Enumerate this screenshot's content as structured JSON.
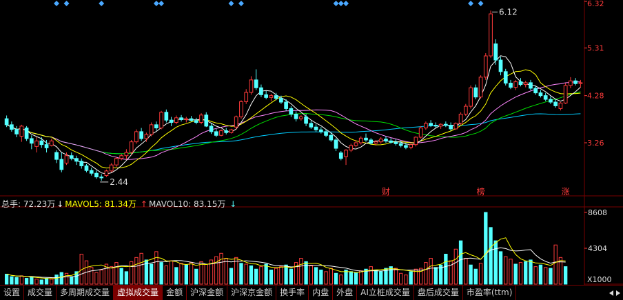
{
  "chart_data": {
    "type": "candlestick",
    "price_axis": {
      "ticks": [
        "6.32",
        "5.31",
        "4.28",
        "3.26"
      ]
    },
    "price_range": [
      2.2,
      6.32
    ],
    "annotations": {
      "max_label": "6.12",
      "min_label": "2.44"
    },
    "event_markers": [
      "财",
      "榜",
      "涨"
    ],
    "volume_axis": {
      "ticks": [
        "8608",
        "4304"
      ],
      "unit": "X1000"
    },
    "volume_range": [
      0,
      8608
    ],
    "colors": {
      "up": "#ff3b3b",
      "down": "#54ffff",
      "ma5": "#ffffff",
      "ma10": "#ffff00",
      "ma20": "#ff88ff",
      "ma30": "#00dd00",
      "ma60": "#00ccff",
      "marker": "#4aa8ff",
      "grid": "#7a0000"
    },
    "candles": [
      {
        "o": 3.78,
        "h": 3.85,
        "l": 3.6,
        "c": 3.65
      },
      {
        "o": 3.65,
        "h": 3.72,
        "l": 3.5,
        "c": 3.55
      },
      {
        "o": 3.55,
        "h": 3.62,
        "l": 3.38,
        "c": 3.45
      },
      {
        "o": 3.4,
        "h": 3.65,
        "l": 3.28,
        "c": 3.62
      },
      {
        "o": 3.58,
        "h": 3.62,
        "l": 3.3,
        "c": 3.35
      },
      {
        "o": 3.35,
        "h": 3.42,
        "l": 3.12,
        "c": 3.25
      },
      {
        "o": 3.18,
        "h": 3.38,
        "l": 3.05,
        "c": 3.3
      },
      {
        "o": 3.3,
        "h": 3.38,
        "l": 3.15,
        "c": 3.22
      },
      {
        "o": 3.22,
        "h": 3.32,
        "l": 3.05,
        "c": 3.15
      },
      {
        "o": 3.2,
        "h": 3.35,
        "l": 3.18,
        "c": 3.3
      },
      {
        "o": 3.05,
        "h": 3.1,
        "l": 2.82,
        "c": 2.9
      },
      {
        "o": 2.9,
        "h": 3.05,
        "l": 2.62,
        "c": 2.68
      },
      {
        "o": 2.82,
        "h": 3.05,
        "l": 2.78,
        "c": 2.98
      },
      {
        "o": 2.98,
        "h": 3.05,
        "l": 2.88,
        "c": 2.92
      },
      {
        "o": 2.92,
        "h": 2.98,
        "l": 2.78,
        "c": 2.86
      },
      {
        "o": 2.86,
        "h": 2.92,
        "l": 2.7,
        "c": 2.76
      },
      {
        "o": 2.76,
        "h": 2.8,
        "l": 2.62,
        "c": 2.66
      },
      {
        "o": 2.66,
        "h": 2.72,
        "l": 2.55,
        "c": 2.6
      },
      {
        "o": 2.6,
        "h": 2.66,
        "l": 2.48,
        "c": 2.52
      },
      {
        "o": 2.52,
        "h": 2.58,
        "l": 2.44,
        "c": 2.5
      },
      {
        "o": 2.55,
        "h": 2.68,
        "l": 2.52,
        "c": 2.65
      },
      {
        "o": 2.65,
        "h": 2.82,
        "l": 2.62,
        "c": 2.78
      },
      {
        "o": 2.78,
        "h": 2.95,
        "l": 2.74,
        "c": 2.92
      },
      {
        "o": 2.92,
        "h": 3.02,
        "l": 2.88,
        "c": 2.98
      },
      {
        "o": 2.98,
        "h": 3.12,
        "l": 2.9,
        "c": 3.05
      },
      {
        "o": 3.05,
        "h": 3.32,
        "l": 3.0,
        "c": 3.28
      },
      {
        "o": 3.28,
        "h": 3.55,
        "l": 3.24,
        "c": 3.5
      },
      {
        "o": 3.5,
        "h": 3.58,
        "l": 3.3,
        "c": 3.35
      },
      {
        "o": 3.35,
        "h": 3.48,
        "l": 3.28,
        "c": 3.44
      },
      {
        "o": 3.44,
        "h": 3.7,
        "l": 3.4,
        "c": 3.65
      },
      {
        "o": 3.65,
        "h": 3.72,
        "l": 3.52,
        "c": 3.58
      },
      {
        "o": 3.58,
        "h": 3.95,
        "l": 3.55,
        "c": 3.92
      },
      {
        "o": 3.92,
        "h": 3.98,
        "l": 3.7,
        "c": 3.75
      },
      {
        "o": 3.75,
        "h": 3.82,
        "l": 3.62,
        "c": 3.7
      },
      {
        "o": 3.7,
        "h": 3.85,
        "l": 3.66,
        "c": 3.8
      },
      {
        "o": 3.8,
        "h": 3.86,
        "l": 3.72,
        "c": 3.76
      },
      {
        "o": 3.76,
        "h": 3.82,
        "l": 3.7,
        "c": 3.78
      },
      {
        "o": 3.78,
        "h": 3.84,
        "l": 3.72,
        "c": 3.74
      },
      {
        "o": 3.74,
        "h": 3.8,
        "l": 3.66,
        "c": 3.7
      },
      {
        "o": 3.7,
        "h": 3.9,
        "l": 3.66,
        "c": 3.86
      },
      {
        "o": 3.86,
        "h": 3.92,
        "l": 3.6,
        "c": 3.62
      },
      {
        "o": 3.62,
        "h": 3.68,
        "l": 3.45,
        "c": 3.5
      },
      {
        "o": 3.5,
        "h": 3.56,
        "l": 3.38,
        "c": 3.42
      },
      {
        "o": 3.42,
        "h": 3.55,
        "l": 3.4,
        "c": 3.52
      },
      {
        "o": 3.52,
        "h": 3.58,
        "l": 3.44,
        "c": 3.48
      },
      {
        "o": 3.48,
        "h": 3.56,
        "l": 3.46,
        "c": 3.54
      },
      {
        "o": 3.6,
        "h": 3.85,
        "l": 3.55,
        "c": 3.82
      },
      {
        "o": 3.82,
        "h": 4.18,
        "l": 3.78,
        "c": 4.15
      },
      {
        "o": 4.15,
        "h": 4.42,
        "l": 4.1,
        "c": 4.35
      },
      {
        "o": 4.35,
        "h": 4.7,
        "l": 4.3,
        "c": 4.62
      },
      {
        "o": 4.62,
        "h": 4.85,
        "l": 4.4,
        "c": 4.45
      },
      {
        "o": 4.45,
        "h": 4.52,
        "l": 4.25,
        "c": 4.3
      },
      {
        "o": 4.3,
        "h": 4.38,
        "l": 4.2,
        "c": 4.24
      },
      {
        "o": 4.24,
        "h": 4.32,
        "l": 4.16,
        "c": 4.28
      },
      {
        "o": 4.28,
        "h": 4.34,
        "l": 4.18,
        "c": 4.22
      },
      {
        "o": 4.22,
        "h": 4.28,
        "l": 4.1,
        "c": 4.14
      },
      {
        "o": 4.14,
        "h": 4.2,
        "l": 3.95,
        "c": 4.0
      },
      {
        "o": 4.0,
        "h": 4.05,
        "l": 3.82,
        "c": 3.88
      },
      {
        "o": 3.88,
        "h": 3.94,
        "l": 3.72,
        "c": 3.78
      },
      {
        "o": 3.78,
        "h": 3.86,
        "l": 3.74,
        "c": 3.82
      },
      {
        "o": 3.82,
        "h": 3.88,
        "l": 3.62,
        "c": 3.68
      },
      {
        "o": 3.68,
        "h": 3.74,
        "l": 3.56,
        "c": 3.6
      },
      {
        "o": 3.6,
        "h": 3.66,
        "l": 3.5,
        "c": 3.54
      },
      {
        "o": 3.54,
        "h": 3.6,
        "l": 3.46,
        "c": 3.5
      },
      {
        "o": 3.5,
        "h": 3.55,
        "l": 3.38,
        "c": 3.42
      },
      {
        "o": 3.42,
        "h": 3.48,
        "l": 3.28,
        "c": 3.32
      },
      {
        "o": 3.32,
        "h": 3.36,
        "l": 3.08,
        "c": 3.14
      },
      {
        "o": 3.04,
        "h": 3.08,
        "l": 2.88,
        "c": 2.92
      },
      {
        "o": 2.96,
        "h": 3.12,
        "l": 2.78,
        "c": 3.1
      },
      {
        "o": 3.1,
        "h": 3.24,
        "l": 3.06,
        "c": 3.2
      },
      {
        "o": 3.2,
        "h": 3.32,
        "l": 3.16,
        "c": 3.26
      },
      {
        "o": 3.26,
        "h": 3.4,
        "l": 3.22,
        "c": 3.36
      },
      {
        "o": 3.36,
        "h": 3.46,
        "l": 3.28,
        "c": 3.32
      },
      {
        "o": 3.32,
        "h": 3.36,
        "l": 3.22,
        "c": 3.25
      },
      {
        "o": 3.25,
        "h": 3.32,
        "l": 3.2,
        "c": 3.28
      },
      {
        "o": 3.28,
        "h": 3.38,
        "l": 3.24,
        "c": 3.34
      },
      {
        "o": 3.34,
        "h": 3.4,
        "l": 3.26,
        "c": 3.3
      },
      {
        "o": 3.3,
        "h": 3.36,
        "l": 3.24,
        "c": 3.27
      },
      {
        "o": 3.27,
        "h": 3.34,
        "l": 3.2,
        "c": 3.24
      },
      {
        "o": 3.24,
        "h": 3.3,
        "l": 3.16,
        "c": 3.2
      },
      {
        "o": 3.2,
        "h": 3.26,
        "l": 3.12,
        "c": 3.16
      },
      {
        "o": 3.16,
        "h": 3.24,
        "l": 3.12,
        "c": 3.22
      },
      {
        "o": 3.22,
        "h": 3.4,
        "l": 3.18,
        "c": 3.38
      },
      {
        "o": 3.38,
        "h": 3.62,
        "l": 3.35,
        "c": 3.58
      },
      {
        "o": 3.58,
        "h": 3.72,
        "l": 3.54,
        "c": 3.68
      },
      {
        "o": 3.68,
        "h": 3.75,
        "l": 3.6,
        "c": 3.64
      },
      {
        "o": 3.64,
        "h": 3.7,
        "l": 3.58,
        "c": 3.62
      },
      {
        "o": 3.62,
        "h": 3.68,
        "l": 3.56,
        "c": 3.66
      },
      {
        "o": 3.66,
        "h": 3.72,
        "l": 3.6,
        "c": 3.64
      },
      {
        "o": 3.64,
        "h": 3.7,
        "l": 3.52,
        "c": 3.56
      },
      {
        "o": 3.56,
        "h": 3.7,
        "l": 3.54,
        "c": 3.68
      },
      {
        "o": 3.68,
        "h": 3.92,
        "l": 3.65,
        "c": 3.88
      },
      {
        "o": 3.88,
        "h": 4.1,
        "l": 3.84,
        "c": 4.05
      },
      {
        "o": 4.05,
        "h": 4.5,
        "l": 4.0,
        "c": 4.45
      },
      {
        "o": 4.45,
        "h": 4.52,
        "l": 4.2,
        "c": 4.25
      },
      {
        "o": 4.25,
        "h": 4.72,
        "l": 4.22,
        "c": 4.68
      },
      {
        "o": 4.68,
        "h": 5.2,
        "l": 4.62,
        "c": 5.14
      },
      {
        "o": 5.14,
        "h": 6.12,
        "l": 5.1,
        "c": 6.05
      },
      {
        "o": 5.4,
        "h": 5.5,
        "l": 4.95,
        "c": 5.05
      },
      {
        "o": 5.05,
        "h": 5.12,
        "l": 4.72,
        "c": 4.8
      },
      {
        "o": 4.8,
        "h": 4.86,
        "l": 4.5,
        "c": 4.55
      },
      {
        "o": 4.55,
        "h": 4.62,
        "l": 4.42,
        "c": 4.46
      },
      {
        "o": 4.46,
        "h": 4.62,
        "l": 4.4,
        "c": 4.58
      },
      {
        "o": 4.58,
        "h": 4.66,
        "l": 4.48,
        "c": 4.52
      },
      {
        "o": 4.52,
        "h": 4.6,
        "l": 4.46,
        "c": 4.56
      },
      {
        "o": 4.56,
        "h": 4.62,
        "l": 4.4,
        "c": 4.44
      },
      {
        "o": 4.44,
        "h": 4.5,
        "l": 4.3,
        "c": 4.34
      },
      {
        "o": 4.34,
        "h": 4.4,
        "l": 4.24,
        "c": 4.28
      },
      {
        "o": 4.28,
        "h": 4.34,
        "l": 4.16,
        "c": 4.2
      },
      {
        "o": 4.2,
        "h": 4.26,
        "l": 4.1,
        "c": 4.14
      },
      {
        "o": 4.14,
        "h": 4.2,
        "l": 4.02,
        "c": 4.06
      },
      {
        "o": 4.0,
        "h": 4.14,
        "l": 3.96,
        "c": 4.12
      },
      {
        "o": 4.12,
        "h": 4.55,
        "l": 4.1,
        "c": 4.5
      },
      {
        "o": 4.5,
        "h": 4.68,
        "l": 4.44,
        "c": 4.6
      },
      {
        "o": 4.6,
        "h": 4.66,
        "l": 4.5,
        "c": 4.54
      },
      {
        "o": 4.54,
        "h": 4.62,
        "l": 4.46,
        "c": 4.56
      }
    ],
    "volumes": [
      {
        "v": 1200,
        "up": false
      },
      {
        "v": 900,
        "up": false
      },
      {
        "v": 800,
        "up": false
      },
      {
        "v": 1000,
        "up": true
      },
      {
        "v": 700,
        "up": false
      },
      {
        "v": 900,
        "up": false
      },
      {
        "v": 600,
        "up": true
      },
      {
        "v": 500,
        "up": false
      },
      {
        "v": 700,
        "up": false
      },
      {
        "v": 600,
        "up": true
      },
      {
        "v": 1100,
        "up": false
      },
      {
        "v": 1400,
        "up": false
      },
      {
        "v": 1300,
        "up": true
      },
      {
        "v": 900,
        "up": false
      },
      {
        "v": 1500,
        "up": false
      },
      {
        "v": 3600,
        "up": true
      },
      {
        "v": 2800,
        "up": true
      },
      {
        "v": 2000,
        "up": true
      },
      {
        "v": 1400,
        "up": true
      },
      {
        "v": 1700,
        "up": true
      },
      {
        "v": 2400,
        "up": true
      },
      {
        "v": 2100,
        "up": true
      },
      {
        "v": 2600,
        "up": true
      },
      {
        "v": 1900,
        "up": false
      },
      {
        "v": 1500,
        "up": false
      },
      {
        "v": 2700,
        "up": true
      },
      {
        "v": 3200,
        "up": true
      },
      {
        "v": 3700,
        "up": true
      },
      {
        "v": 2900,
        "up": false
      },
      {
        "v": 2400,
        "up": false
      },
      {
        "v": 3900,
        "up": true
      },
      {
        "v": 2600,
        "up": false
      },
      {
        "v": 2200,
        "up": true
      },
      {
        "v": 2800,
        "up": true
      },
      {
        "v": 2000,
        "up": false
      },
      {
        "v": 2500,
        "up": true
      },
      {
        "v": 2300,
        "up": false
      },
      {
        "v": 2600,
        "up": true
      },
      {
        "v": 1800,
        "up": false
      },
      {
        "v": 2700,
        "up": true
      },
      {
        "v": 2400,
        "up": true
      },
      {
        "v": 2900,
        "up": true
      },
      {
        "v": 3300,
        "up": true
      },
      {
        "v": 3700,
        "up": true
      },
      {
        "v": 3100,
        "up": true
      },
      {
        "v": 1900,
        "up": false
      },
      {
        "v": 3200,
        "up": true
      },
      {
        "v": 2500,
        "up": false
      },
      {
        "v": 2400,
        "up": true
      },
      {
        "v": 2200,
        "up": false
      },
      {
        "v": 1800,
        "up": false
      },
      {
        "v": 2100,
        "up": true
      },
      {
        "v": 2400,
        "up": false
      },
      {
        "v": 1700,
        "up": false
      },
      {
        "v": 1900,
        "up": true
      },
      {
        "v": 2100,
        "up": true
      },
      {
        "v": 2300,
        "up": false
      },
      {
        "v": 1800,
        "up": false
      },
      {
        "v": 2600,
        "up": true
      },
      {
        "v": 3100,
        "up": true
      },
      {
        "v": 2700,
        "up": false
      },
      {
        "v": 2200,
        "up": true
      },
      {
        "v": 2000,
        "up": false
      },
      {
        "v": 1700,
        "up": false
      },
      {
        "v": 1500,
        "up": true
      },
      {
        "v": 1900,
        "up": true
      },
      {
        "v": 1300,
        "up": false
      },
      {
        "v": 1100,
        "up": true
      },
      {
        "v": 1700,
        "up": false
      },
      {
        "v": 1500,
        "up": false
      },
      {
        "v": 1400,
        "up": false
      },
      {
        "v": 1600,
        "up": true
      },
      {
        "v": 1800,
        "up": false
      },
      {
        "v": 2100,
        "up": true
      },
      {
        "v": 1700,
        "up": false
      },
      {
        "v": 1500,
        "up": false
      },
      {
        "v": 1900,
        "up": false
      },
      {
        "v": 2100,
        "up": false
      },
      {
        "v": 1900,
        "up": true
      },
      {
        "v": 1300,
        "up": true
      },
      {
        "v": 1100,
        "up": true
      },
      {
        "v": 1500,
        "up": false
      },
      {
        "v": 1800,
        "up": true
      },
      {
        "v": 1900,
        "up": true
      },
      {
        "v": 2600,
        "up": true
      },
      {
        "v": 3100,
        "up": true
      },
      {
        "v": 2000,
        "up": false
      },
      {
        "v": 2300,
        "up": false
      },
      {
        "v": 3600,
        "up": false
      },
      {
        "v": 2800,
        "up": true
      },
      {
        "v": 4200,
        "up": true
      },
      {
        "v": 5200,
        "up": false
      },
      {
        "v": 3100,
        "up": true
      },
      {
        "v": 2300,
        "up": false
      },
      {
        "v": 1800,
        "up": false
      },
      {
        "v": 2500,
        "up": true
      },
      {
        "v": 8608,
        "up": false
      },
      {
        "v": 6800,
        "up": false
      },
      {
        "v": 5200,
        "up": false
      },
      {
        "v": 3900,
        "up": false
      },
      {
        "v": 3300,
        "up": true
      },
      {
        "v": 3000,
        "up": true
      },
      {
        "v": 2400,
        "up": false
      },
      {
        "v": 2600,
        "up": true
      },
      {
        "v": 2700,
        "up": false
      },
      {
        "v": 2900,
        "up": false
      },
      {
        "v": 2100,
        "up": true
      },
      {
        "v": 2300,
        "up": false
      },
      {
        "v": 2000,
        "up": true
      },
      {
        "v": 1900,
        "up": false
      },
      {
        "v": 4700,
        "up": true
      },
      {
        "v": 3200,
        "up": true
      },
      {
        "v": 2100,
        "up": false
      }
    ],
    "markers_top_index": [
      10,
      12,
      19,
      30,
      31,
      45,
      47,
      66,
      67,
      68,
      93,
      95
    ]
  },
  "volume_header": {
    "total_label": "总手: 72.23万",
    "mavol5_label": "MAVOL5: 81.34万",
    "mavol10_label": "MAVOL10: 83.15万"
  },
  "tabs": [
    {
      "label": "设置",
      "active": false
    },
    {
      "label": "成交量",
      "active": false
    },
    {
      "label": "多周期成交量",
      "active": false
    },
    {
      "label": "虚拟成交量",
      "active": true
    },
    {
      "label": "金额",
      "active": false
    },
    {
      "label": "沪深金额",
      "active": false
    },
    {
      "label": "沪深京金额",
      "active": false
    },
    {
      "label": "换手率",
      "active": false
    },
    {
      "label": "内盘",
      "active": false
    },
    {
      "label": "外盘",
      "active": false
    },
    {
      "label": "AI立桩成交量",
      "active": false
    },
    {
      "label": "盘后成交量",
      "active": false
    },
    {
      "label": "市盈率(ttm)",
      "active": false
    }
  ]
}
